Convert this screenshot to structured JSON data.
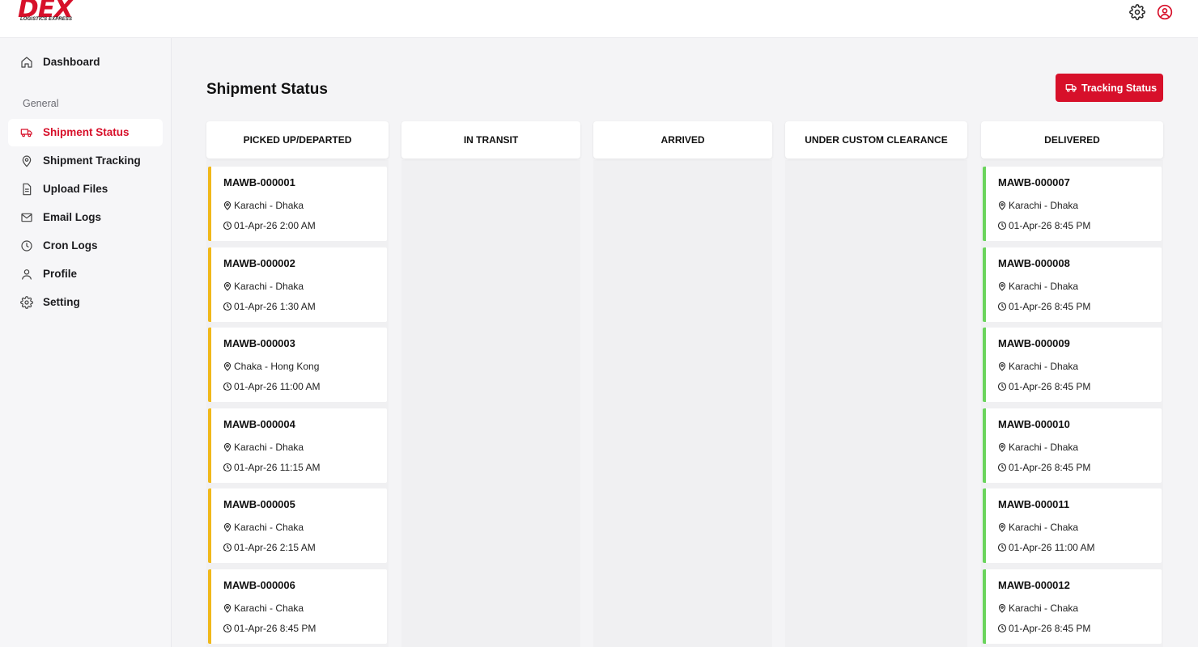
{
  "brand": {
    "name": "DEX",
    "tagline": "LOGISTICS EXPRESS",
    "accent": "#d7102a"
  },
  "sidebar": {
    "dashboard": "Dashboard",
    "section": "General",
    "items": [
      {
        "label": "Shipment Status",
        "icon": "truck-icon",
        "active": true
      },
      {
        "label": "Shipment Tracking",
        "icon": "location-pin-icon"
      },
      {
        "label": "Upload Files",
        "icon": "file-icon"
      },
      {
        "label": "Email Logs",
        "icon": "mail-icon"
      },
      {
        "label": "Cron Logs",
        "icon": "clock-icon"
      },
      {
        "label": "Profile",
        "icon": "user-icon"
      },
      {
        "label": "Setting",
        "icon": "gear-icon"
      }
    ]
  },
  "main": {
    "title": "Shipment Status",
    "tracking_button": "Tracking Status",
    "columns": [
      "PICKED UP/DEPARTED",
      "IN TRANSIT",
      "ARRIVED",
      "UNDER CUSTOM CLEARANCE",
      "DELIVERED"
    ],
    "picked_up": [
      {
        "mawb": "MAWB-000001",
        "route": "Karachi - Dhaka",
        "time": "01-Apr-26 2:00 AM"
      },
      {
        "mawb": "MAWB-000002",
        "route": "Karachi - Dhaka",
        "time": "01-Apr-26 1:30 AM"
      },
      {
        "mawb": "MAWB-000003",
        "route": "Chaka - Hong Kong",
        "time": "01-Apr-26 11:00 AM"
      },
      {
        "mawb": "MAWB-000004",
        "route": "Karachi - Dhaka",
        "time": "01-Apr-26 11:15 AM"
      },
      {
        "mawb": "MAWB-000005",
        "route": "Karachi - Chaka",
        "time": "01-Apr-26 2:15 AM"
      },
      {
        "mawb": "MAWB-000006",
        "route": "Karachi - Chaka",
        "time": "01-Apr-26 8:45 PM"
      }
    ],
    "delivered": [
      {
        "mawb": "MAWB-000007",
        "route": "Karachi - Dhaka",
        "time": "01-Apr-26 8:45 PM"
      },
      {
        "mawb": "MAWB-000008",
        "route": "Karachi - Dhaka",
        "time": "01-Apr-26 8:45 PM"
      },
      {
        "mawb": "MAWB-000009",
        "route": "Karachi - Dhaka",
        "time": "01-Apr-26 8:45 PM"
      },
      {
        "mawb": "MAWB-000010",
        "route": "Karachi - Dhaka",
        "time": "01-Apr-26 8:45 PM"
      },
      {
        "mawb": "MAWB-000011",
        "route": "Karachi - Chaka",
        "time": "01-Apr-26 11:00 AM"
      },
      {
        "mawb": "MAWB-000012",
        "route": "Karachi - Chaka",
        "time": "01-Apr-26 8:45 PM"
      }
    ],
    "status_colors": {
      "picked_up": "#f0b81a",
      "delivered": "#6ad45c"
    }
  }
}
